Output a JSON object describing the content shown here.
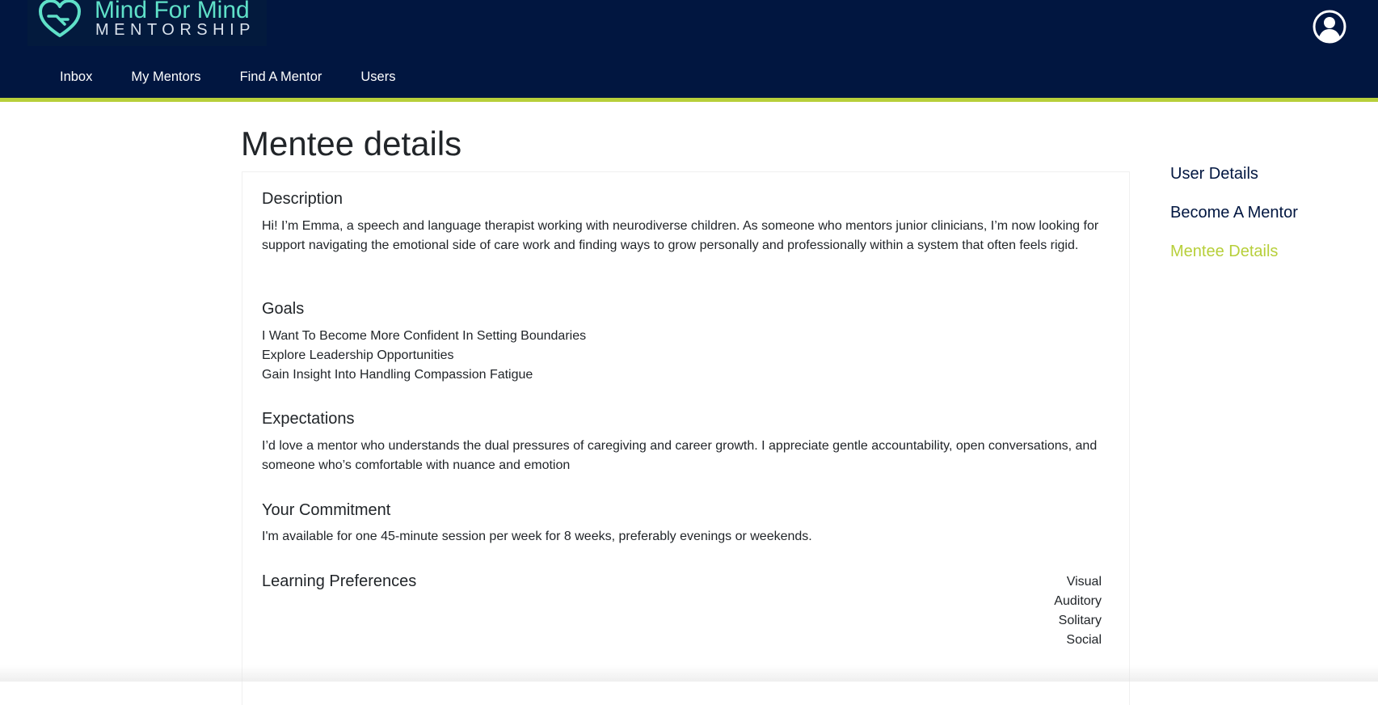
{
  "brand": {
    "title": "Mind For Mind",
    "subtitle": "MENTORSHIP"
  },
  "nav": {
    "items": [
      {
        "label": "Inbox"
      },
      {
        "label": "My Mentors"
      },
      {
        "label": "Find A Mentor"
      },
      {
        "label": "Users"
      }
    ]
  },
  "page": {
    "title": "Mentee details"
  },
  "description": {
    "heading": "Description",
    "text": "Hi! I’m Emma, a speech and language therapist working with neurodiverse children. As someone who mentors junior clinicians, I’m now looking for support navigating the emotional side of care work and finding ways to grow personally and professionally within a system that often feels rigid."
  },
  "goals": {
    "heading": "Goals",
    "items": [
      "I Want To Become More Confident In Setting Boundaries",
      "Explore Leadership Opportunities",
      "Gain Insight Into Handling Compassion Fatigue"
    ]
  },
  "expectations": {
    "heading": "Expectations",
    "text": "I’d love a mentor who understands the dual pressures of caregiving and career growth. I appreciate gentle accountability, open conversations, and someone who’s comfortable with nuance and emotion"
  },
  "commitment": {
    "heading": "Your Commitment",
    "text": "I'm available for one 45-minute session per week for 8 weeks, preferably evenings or weekends."
  },
  "learning": {
    "heading": "Learning Preferences",
    "items": [
      "Visual",
      "Auditory",
      "Solitary",
      "Social"
    ]
  },
  "side_nav": {
    "items": [
      {
        "label": "User Details"
      },
      {
        "label": "Become A Mentor"
      },
      {
        "label": "Mentee Details"
      }
    ],
    "active": "Mentee Details"
  },
  "colors": {
    "header_bg": "#011640",
    "accent": "#b7cf3a",
    "logo_teal": "#5fe0c8"
  },
  "icons": {
    "logo": "heart-handshake-icon",
    "account": "user-circle-icon"
  }
}
